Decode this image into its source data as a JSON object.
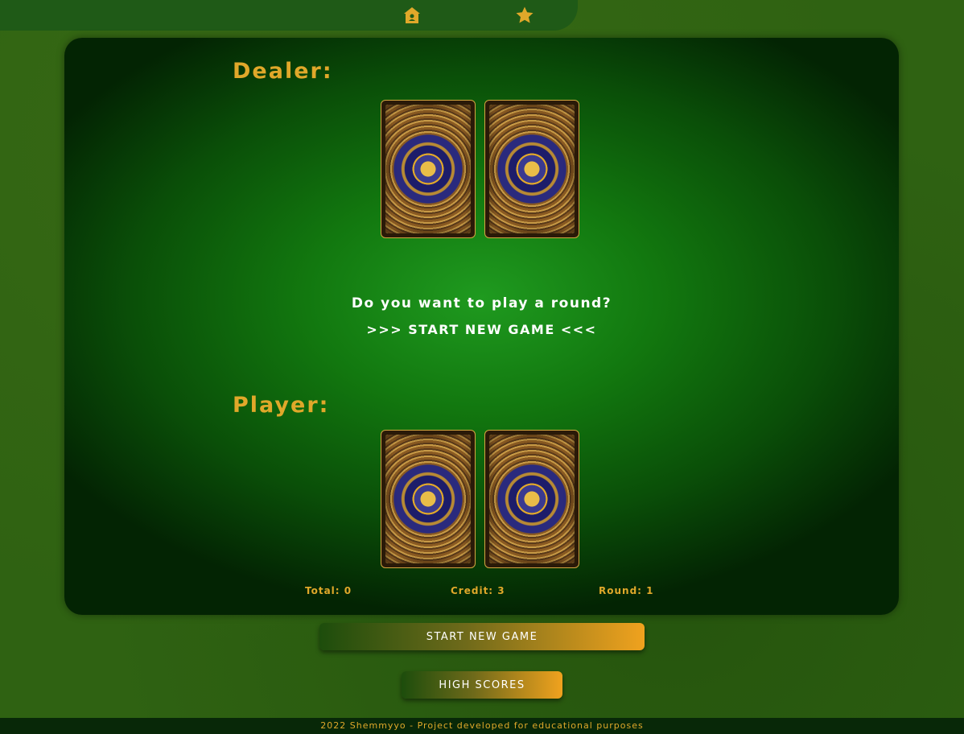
{
  "nav": {
    "home_icon": "home-icon",
    "star_icon": "star-icon",
    "icon_color": "#e0a82a"
  },
  "table": {
    "dealer_label": "Dealer:",
    "player_label": "Player:",
    "prompt_question": "Do you want to play a round?",
    "prompt_start": ">>> START NEW GAME <<<",
    "dealer_cards": [
      "card-back",
      "card-back"
    ],
    "player_cards": [
      "card-back",
      "card-back"
    ],
    "stats": {
      "total": "Total: 0",
      "credit": "Credit: 3",
      "round": "Round: 1"
    }
  },
  "buttons": {
    "start_new_game": "START NEW GAME",
    "high_scores": "HIGH SCORES"
  },
  "footer": {
    "text": "2022 Shemmyyo - Project developed for educational purposes"
  },
  "colors": {
    "accent": "#e0a82a",
    "felt": "#12780f",
    "background": "#2f6212"
  }
}
